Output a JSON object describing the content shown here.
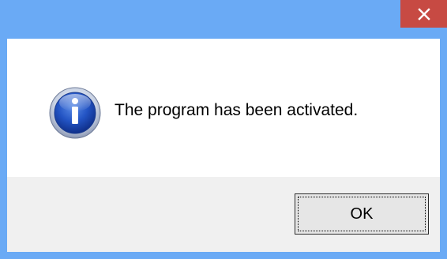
{
  "window": {
    "close_glyph": "✕",
    "close_icon": "close-icon",
    "titlebar_color": "#6aaaf5",
    "close_color": "#c74a43"
  },
  "dialog": {
    "icon": "info-icon",
    "message": "The program has been activated.",
    "ok_label": "OK"
  }
}
